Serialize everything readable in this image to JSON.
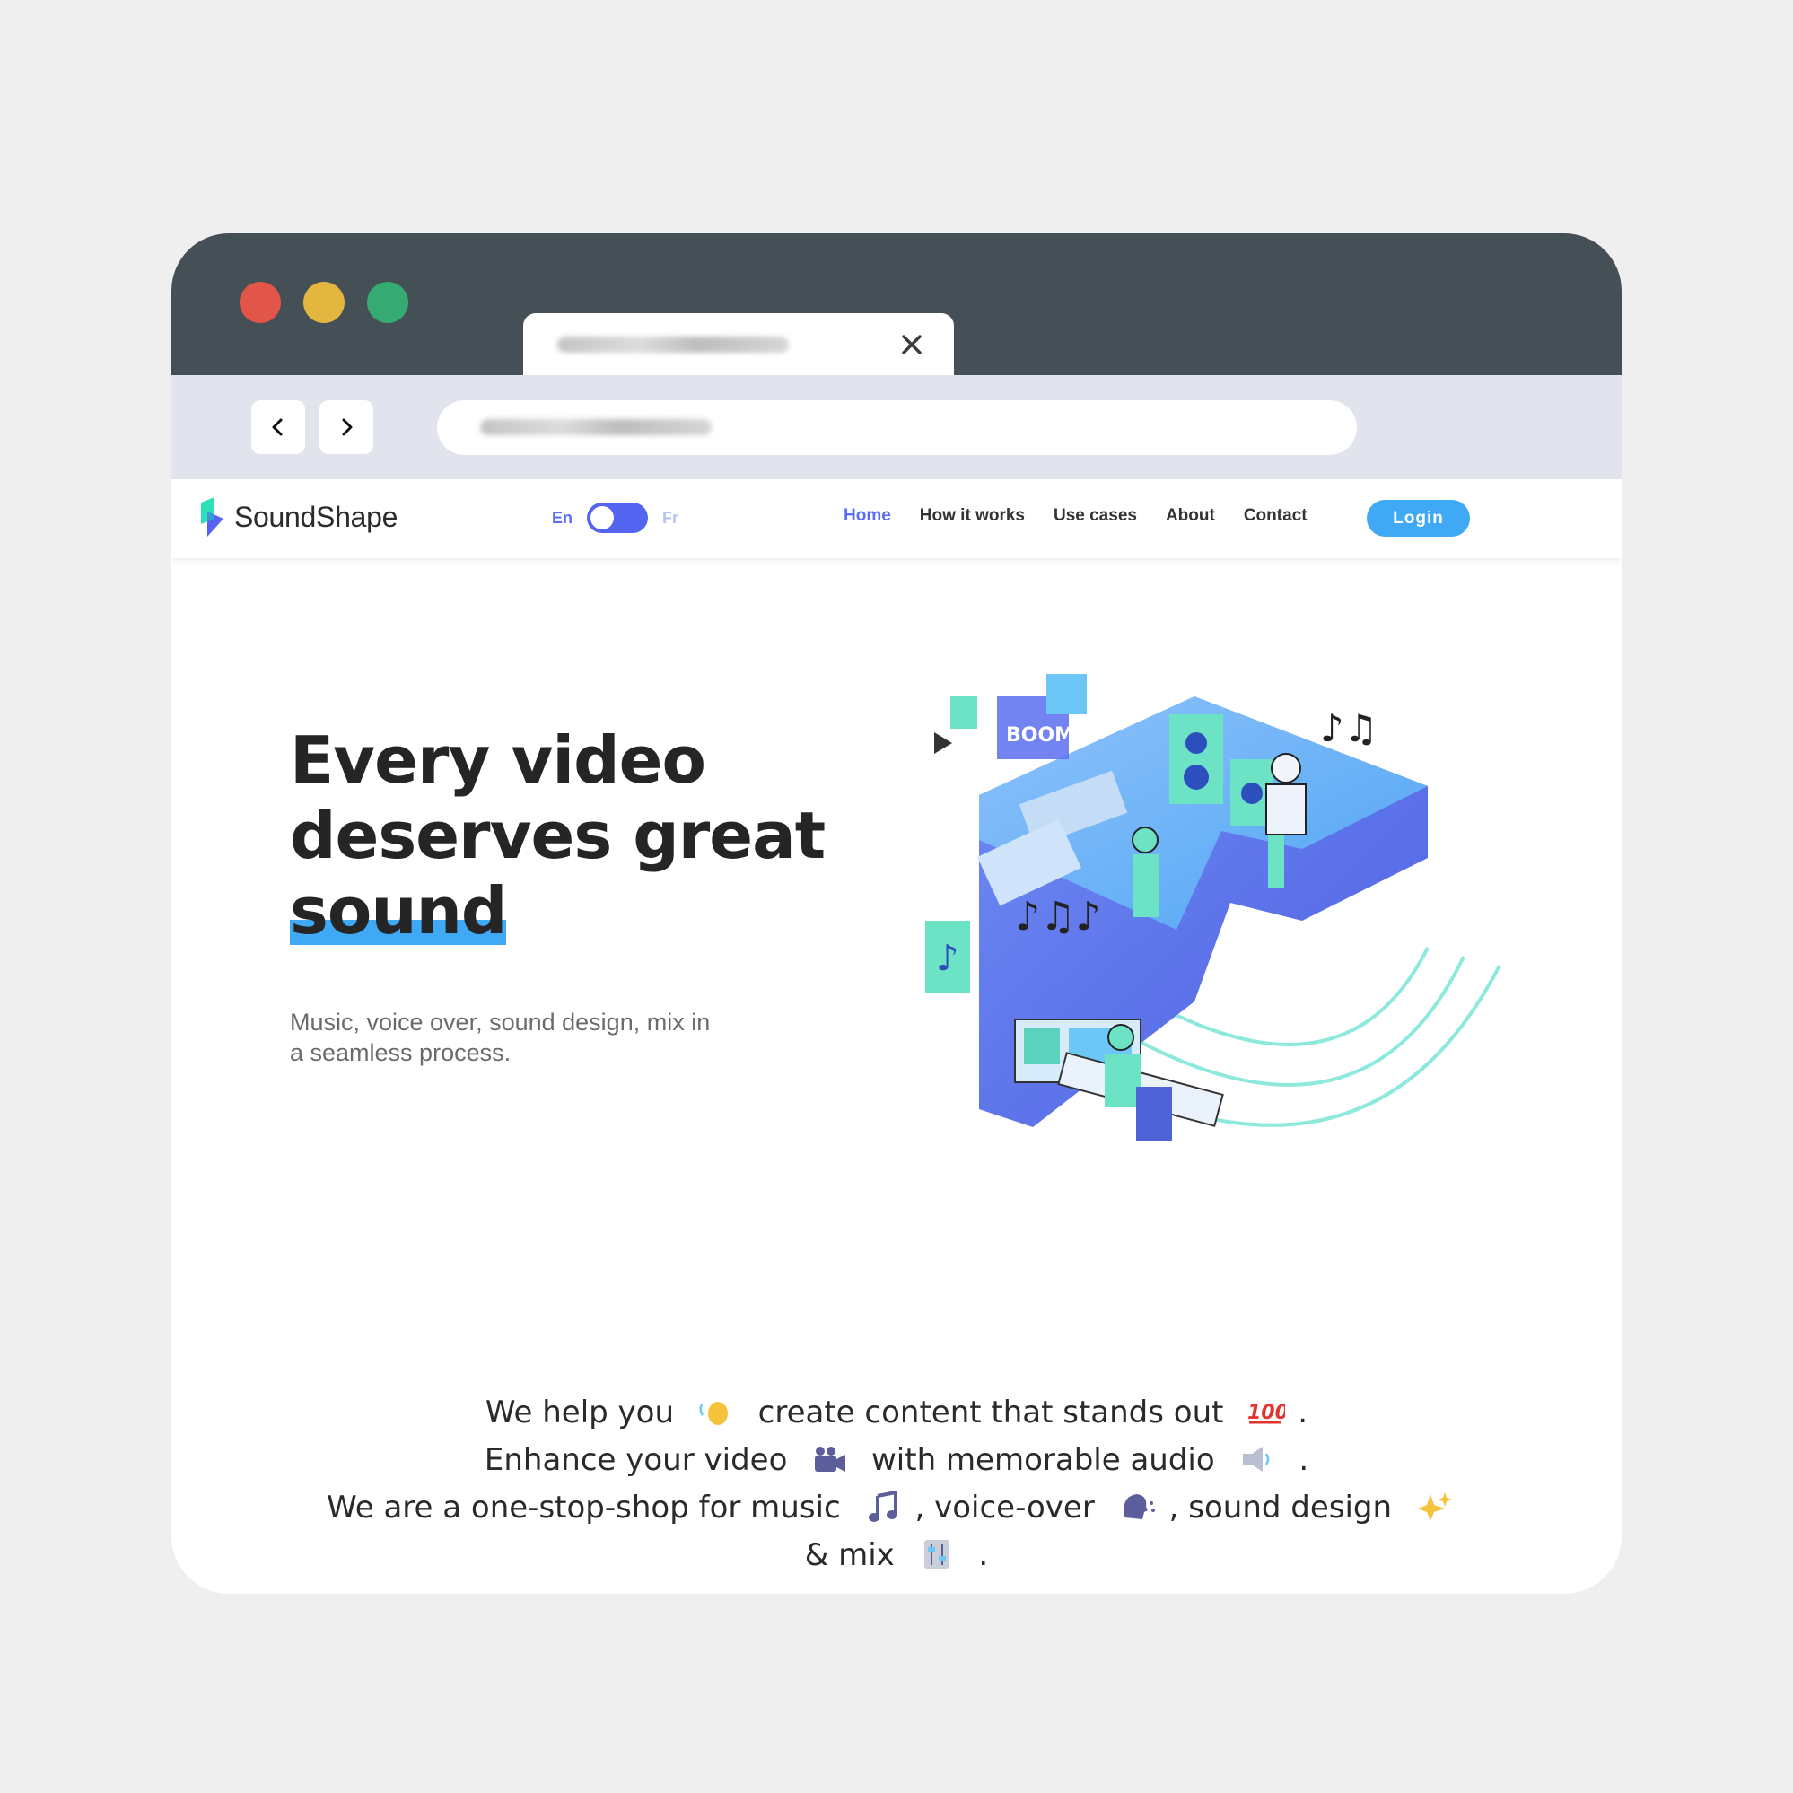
{
  "brand": {
    "name": "SoundShape"
  },
  "language": {
    "en": "En",
    "fr": "Fr"
  },
  "nav": {
    "items": [
      {
        "label": "Home",
        "active": true
      },
      {
        "label": "How it works"
      },
      {
        "label": "Use cases"
      },
      {
        "label": "About"
      },
      {
        "label": "Contact"
      }
    ],
    "login": "Login"
  },
  "hero": {
    "line1": "Every video",
    "line2": "deserves great",
    "line3": "sound",
    "subtitle": "Music, voice over, sound design, mix in a seamless process."
  },
  "tagline": {
    "p1": "We help you",
    "p2": "create content that stands out",
    "p3": ".",
    "p4": "Enhance your video",
    "p5": "with memorable audio",
    "p6": ".",
    "p7": "We are a one-stop-shop for music",
    "p8": ", voice-over",
    "p9": ", sound design",
    "p10": "& mix",
    "p11": "."
  },
  "colors": {
    "accent": "#5b6ef0",
    "button": "#3fa9f5",
    "titlebar": "#454f56",
    "toolbar": "#e1e4ed"
  },
  "icons": [
    "close-icon",
    "chevron-left-icon",
    "chevron-right-icon",
    "waving-hand-icon",
    "hundred-icon",
    "video-camera-icon",
    "speaker-icon",
    "music-note-icon",
    "speaking-head-icon",
    "sparkles-icon",
    "mixer-icon"
  ]
}
